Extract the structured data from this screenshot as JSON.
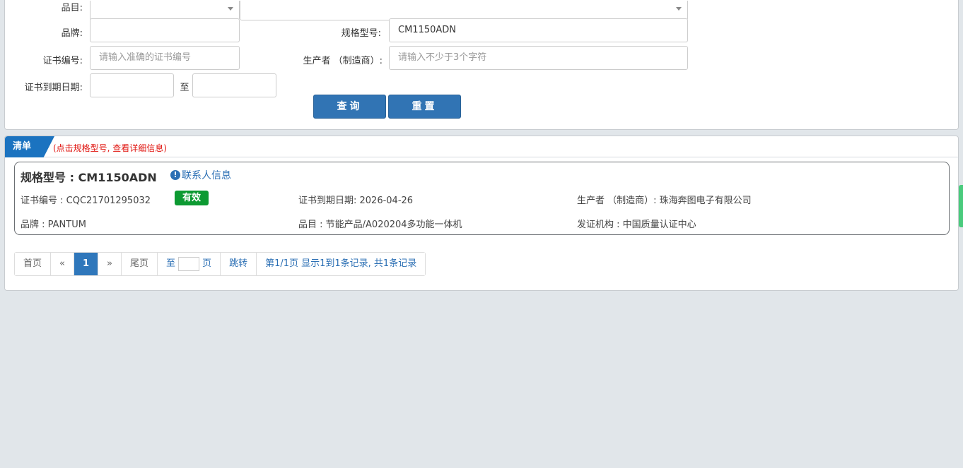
{
  "search": {
    "category_label": "品目:",
    "brand_label": "品牌:",
    "brand_value": "",
    "model_label": "规格型号:",
    "model_value": "CM1150ADN",
    "cert_no_label": "证书编号:",
    "cert_no_placeholder": "请输入准确的证书编号",
    "manufacturer_label": "生产者 （制造商）:",
    "manufacturer_placeholder": "请输入不少于3个字符",
    "expiry_label": "证书到期日期:",
    "to_label": "至",
    "query_button": "查询",
    "reset_button": "重置"
  },
  "list": {
    "tab_label": "清单",
    "hint": "(点击规格型号, 查看详细信息)",
    "result": {
      "title": "规格型号 : CM1150ADN",
      "contact_link": "联系人信息",
      "cert_no": "证书编号 : CQC21701295032",
      "status": "有效",
      "expiry": "证书到期日期: 2026-04-26",
      "manufacturer": "生产者 （制造商）: 珠海奔图电子有限公司",
      "brand": "品牌 : PANTUM",
      "category": "品目 : 节能产品/A020204多功能一体机",
      "issuer": "发证机构 : 中国质量认证中心"
    }
  },
  "pagination": {
    "first": "首页",
    "prev": "«",
    "current": "1",
    "next": "»",
    "last": "尾页",
    "goto_prefix": "至",
    "goto_suffix": "页",
    "jump": "跳转",
    "summary": "第1/1页  显示1到1条记录, 共1条记录"
  },
  "colors": {
    "primary": "#3174b4",
    "status_green": "#0d9a32",
    "hint_red": "#e0140f",
    "tab_blue": "#1b73c0"
  }
}
